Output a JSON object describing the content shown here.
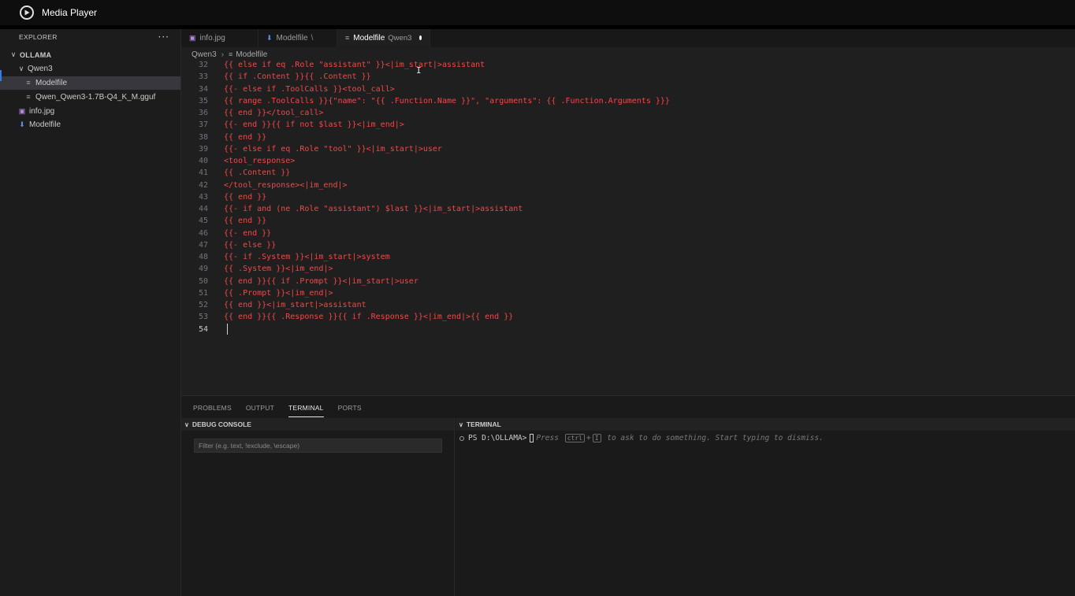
{
  "window": {
    "title": "Media Player"
  },
  "sidebar": {
    "header": "EXPLORER",
    "more": "···",
    "tree": [
      {
        "label": "OLLAMA",
        "depth": 0,
        "type": "folder-open",
        "root": true
      },
      {
        "label": "Qwen3",
        "depth": 1,
        "type": "folder-open"
      },
      {
        "label": "Modelfile",
        "depth": 2,
        "type": "file-lines",
        "selected": true
      },
      {
        "label": "Qwen_Qwen3-1.7B-Q4_K_M.gguf",
        "depth": 2,
        "type": "file-lines"
      },
      {
        "label": "info.jpg",
        "depth": 1,
        "type": "file-image"
      },
      {
        "label": "Modelfile",
        "depth": 1,
        "type": "file-download"
      }
    ]
  },
  "tabs": [
    {
      "label": "info.jpg",
      "icon": "image-icon"
    },
    {
      "label": "Modelfile",
      "icon": "download-icon",
      "suffix": "\\"
    },
    {
      "label": "Modelfile",
      "icon": "lines-icon",
      "description": "Qwen3",
      "active": true,
      "dirty": true
    }
  ],
  "breadcrumb": {
    "folder": "Qwen3",
    "file": "Modelfile"
  },
  "editor": {
    "lines": [
      {
        "n": "32",
        "text": "{{ else if eq .Role \"assistant\" }}<|im_start|>assistant"
      },
      {
        "n": "33",
        "text": "{{ if .Content }}{{ .Content }}"
      },
      {
        "n": "34",
        "text": "{{- else if .ToolCalls }}<tool_call>"
      },
      {
        "n": "35",
        "text": "{{ range .ToolCalls }}{\"name\": \"{{ .Function.Name }}\", \"arguments\": {{ .Function.Arguments }}}"
      },
      {
        "n": "36",
        "text": "{{ end }}</tool_call>"
      },
      {
        "n": "37",
        "text": "{{- end }}{{ if not $last }}<|im_end|>"
      },
      {
        "n": "38",
        "text": "{{ end }}"
      },
      {
        "n": "39",
        "text": "{{- else if eq .Role \"tool\" }}<|im_start|>user"
      },
      {
        "n": "40",
        "text": "<tool_response>"
      },
      {
        "n": "41",
        "text": "{{ .Content }}"
      },
      {
        "n": "42",
        "text": "</tool_response><|im_end|>"
      },
      {
        "n": "43",
        "text": "{{ end }}"
      },
      {
        "n": "44",
        "text": "{{- if and (ne .Role \"assistant\") $last }}<|im_start|>assistant"
      },
      {
        "n": "45",
        "text": "{{ end }}"
      },
      {
        "n": "46",
        "text": "{{- end }}"
      },
      {
        "n": "47",
        "text": "{{- else }}"
      },
      {
        "n": "48",
        "text": "{{- if .System }}<|im_start|>system"
      },
      {
        "n": "49",
        "text": "{{ .System }}<|im_end|>"
      },
      {
        "n": "50",
        "text": "{{ end }}{{ if .Prompt }}<|im_start|>user"
      },
      {
        "n": "51",
        "text": "{{ .Prompt }}<|im_end|>"
      },
      {
        "n": "52",
        "text": "{{ end }}<|im_start|>assistant"
      },
      {
        "n": "53",
        "text": "{{ end }}{{ .Response }}{{ if .Response }}<|im_end|>{{ end }}"
      },
      {
        "n": "54",
        "text": "",
        "current": true
      }
    ]
  },
  "panel": {
    "tabs": [
      {
        "label": "PROBLEMS"
      },
      {
        "label": "OUTPUT"
      },
      {
        "label": "TERMINAL",
        "active": true
      },
      {
        "label": "PORTS"
      }
    ],
    "debug": {
      "title": "DEBUG CONSOLE",
      "filter_placeholder": "Filter (e.g. text, !exclude, \\escape)"
    },
    "terminal": {
      "title": "TERMINAL",
      "prompt": "PS D:\\OLLAMA>",
      "hint_press": "Press",
      "key1": "ctrl",
      "plus": "+",
      "key2": "I",
      "hint_rest": "to ask to do something. Start typing to dismiss."
    }
  },
  "colors": {
    "code": "#f44747",
    "accent": "#3b7ae0"
  }
}
